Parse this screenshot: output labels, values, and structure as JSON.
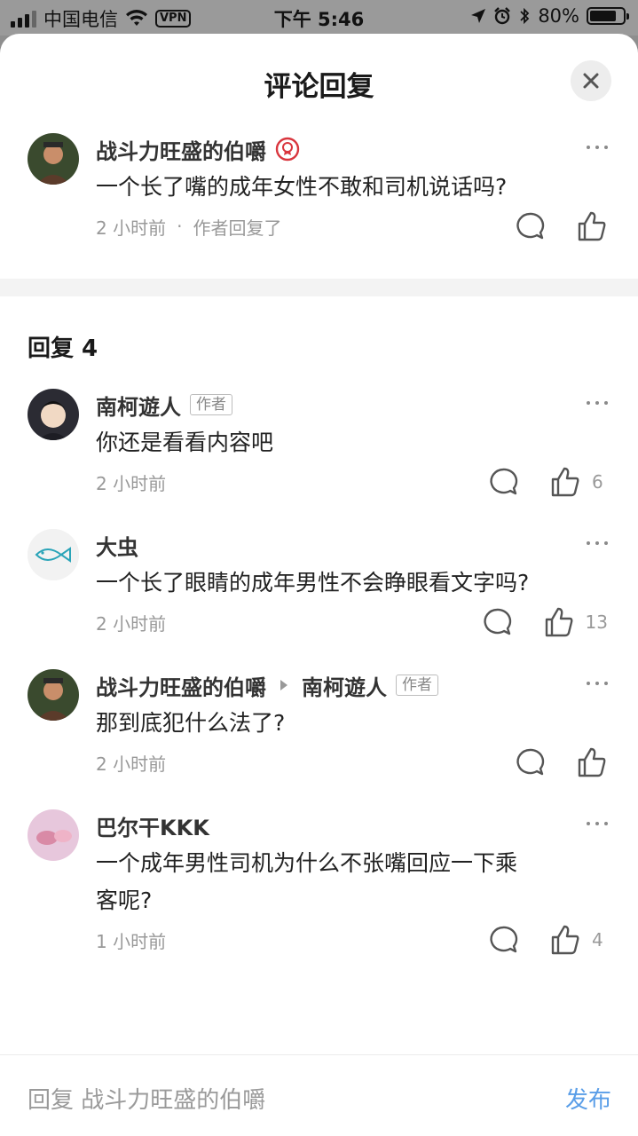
{
  "status_bar": {
    "carrier": "中国电信",
    "vpn": "VPN",
    "time": "下午 5:46",
    "battery": "80%",
    "battery_level": 0.8
  },
  "sheet": {
    "title": "评论回复"
  },
  "top_comment": {
    "user": "战斗力旺盛的伯嚼",
    "text": "一个长了嘴的成年女性不敢和司机说话吗?",
    "time": "2 小时前",
    "separator": "·",
    "author_replied": "作者回复了"
  },
  "replies_section": {
    "title": "回复 4"
  },
  "replies": [
    {
      "user": "南柯遊人",
      "badge": "作者",
      "text": "你还是看看内容吧",
      "time": "2 小时前",
      "likes": "6"
    },
    {
      "user": "大虫",
      "text": "一个长了眼睛的成年男性不会睁眼看文字吗?",
      "time": "2 小时前",
      "likes": "13"
    },
    {
      "user": "战斗力旺盛的伯嚼",
      "reply_to": "南柯遊人",
      "reply_to_badge": "作者",
      "text": "那到底犯什么法了?",
      "time": "2 小时前",
      "likes": ""
    },
    {
      "user": "巴尔干KKK",
      "text_line1": "一个成年男性司机为什么不张嘴回应一下乘",
      "text_line2": "客呢?",
      "time": "1 小时前",
      "likes": "4"
    }
  ],
  "bottom_bar": {
    "placeholder": "回复 战斗力旺盛的伯嚼",
    "publish": "发布"
  },
  "colors": {
    "accent": "#5a9ee8",
    "muted": "#999999",
    "overlay": "#8e8e8e"
  }
}
